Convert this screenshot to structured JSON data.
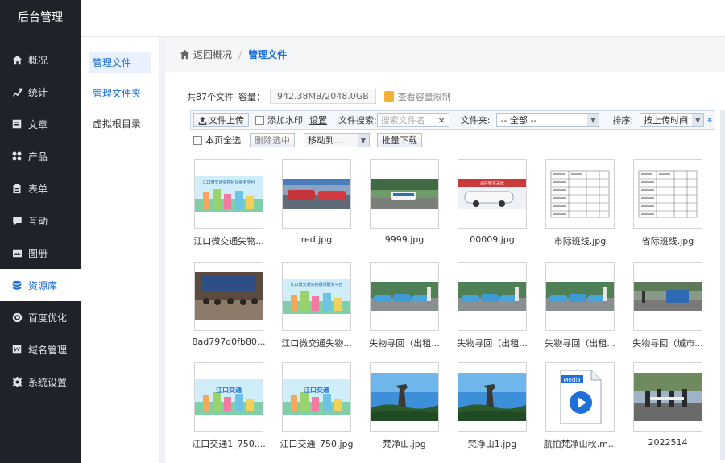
{
  "app": {
    "title": "后台管理"
  },
  "sidebar": {
    "items": [
      {
        "label": "概况",
        "icon": "home-icon"
      },
      {
        "label": "统计",
        "icon": "chart-icon"
      },
      {
        "label": "文章",
        "icon": "article-icon"
      },
      {
        "label": "产品",
        "icon": "product-grid-icon"
      },
      {
        "label": "表单",
        "icon": "form-icon"
      },
      {
        "label": "互动",
        "icon": "chat-icon"
      },
      {
        "label": "图册",
        "icon": "gallery-icon"
      },
      {
        "label": "资源库",
        "icon": "database-icon",
        "active": true
      },
      {
        "label": "百度优化",
        "icon": "seo-icon"
      },
      {
        "label": "域名管理",
        "icon": "domain-icon"
      },
      {
        "label": "系统设置",
        "icon": "gear-icon"
      }
    ]
  },
  "subnav": {
    "items": [
      {
        "label": "管理文件",
        "active": true
      },
      {
        "label": "管理文件夹"
      },
      {
        "label": "虚拟根目录"
      }
    ]
  },
  "breadcrumb": {
    "back": "返回概况",
    "separator": "/",
    "current": "管理文件"
  },
  "summary": {
    "count_text": "共87个文件",
    "capacity_label": "容量：",
    "capacity_value": "942.38MB/2048.0GB",
    "limit_link": "查看容量限制"
  },
  "toolbar": {
    "upload_label": "文件上传",
    "watermark_label": "添加水印",
    "settings_label": "设置",
    "search_label": "文件搜索:",
    "search_placeholder": "搜索文件名",
    "search_clear": "×",
    "folder_label": "文件夹:",
    "folder_value": "-- 全部 --",
    "sort_label": "排序:",
    "sort_value": "按上传时间",
    "expand_glyph": "»"
  },
  "toolbar2": {
    "select_all_label": "本页全选",
    "delete_label": "删除选中",
    "move_value": "移动到...",
    "download_label": "批量下载"
  },
  "files": [
    {
      "name": "江口微交通失物...",
      "kind": "banner"
    },
    {
      "name": "red.jpg",
      "kind": "photo-red"
    },
    {
      "name": "9999.jpg",
      "kind": "photo-bus"
    },
    {
      "name": "00009.jpg",
      "kind": "photo-car"
    },
    {
      "name": "市际班线.jpg",
      "kind": "table"
    },
    {
      "name": "省际班线.jpg",
      "kind": "table"
    },
    {
      "name": "8ad797d0fb80...",
      "kind": "photo-meeting"
    },
    {
      "name": "江口微交通失物...",
      "kind": "banner"
    },
    {
      "name": "失物寻回（出租...",
      "kind": "photo-taxi"
    },
    {
      "name": "失物寻回（出租...",
      "kind": "photo-taxi"
    },
    {
      "name": "失物寻回（出租...",
      "kind": "photo-taxi"
    },
    {
      "name": "失物寻回（城市...",
      "kind": "photo-street"
    },
    {
      "name": "江口交通1_750....",
      "kind": "banner2"
    },
    {
      "name": "江口交通_750.jpg",
      "kind": "banner2"
    },
    {
      "name": "梵净山.jpg",
      "kind": "photo-mountain"
    },
    {
      "name": "梵净山1.jpg",
      "kind": "photo-mountain"
    },
    {
      "name": "航拍梵净山秋.m...",
      "kind": "media"
    },
    {
      "name": "2022514",
      "kind": "photo-people"
    }
  ],
  "media_badge": "Media",
  "banner_text": "江口微交通失物招领服务平台",
  "banner2_text": "江口交通",
  "car_text": "出行畅享无忧",
  "colors": {
    "accent": "#1e70d8",
    "sidebar_bg": "#1f2329"
  }
}
